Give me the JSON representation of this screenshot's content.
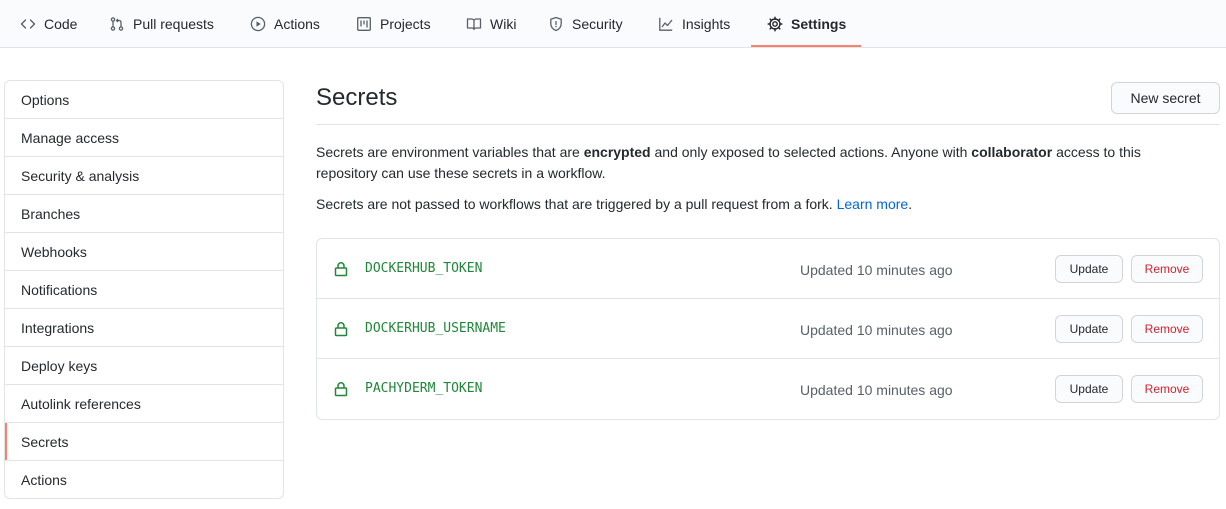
{
  "nav": {
    "tabs": [
      {
        "label": "Code",
        "icon": "code-icon"
      },
      {
        "label": "Pull requests",
        "icon": "pull-request-icon"
      },
      {
        "label": "Actions",
        "icon": "play-icon"
      },
      {
        "label": "Projects",
        "icon": "project-icon"
      },
      {
        "label": "Wiki",
        "icon": "book-icon"
      },
      {
        "label": "Security",
        "icon": "shield-icon"
      },
      {
        "label": "Insights",
        "icon": "graph-icon"
      },
      {
        "label": "Settings",
        "icon": "gear-icon",
        "active": true
      }
    ],
    "accent_color": "#f9826c"
  },
  "sidebar": {
    "items": [
      {
        "label": "Options"
      },
      {
        "label": "Manage access"
      },
      {
        "label": "Security & analysis"
      },
      {
        "label": "Branches"
      },
      {
        "label": "Webhooks"
      },
      {
        "label": "Notifications"
      },
      {
        "label": "Integrations"
      },
      {
        "label": "Deploy keys"
      },
      {
        "label": "Autolink references"
      },
      {
        "label": "Secrets",
        "active": true
      },
      {
        "label": "Actions"
      }
    ]
  },
  "main": {
    "title": "Secrets",
    "new_button": "New secret",
    "desc1": {
      "part1": "Secrets are environment variables that are ",
      "bold1": "encrypted",
      "part2": " and only exposed to selected actions. Anyone with ",
      "bold2": "collaborator",
      "part3": " access to this repository can use these secrets in a workflow."
    },
    "desc2": {
      "text": "Secrets are not passed to workflows that are triggered by a pull request from a fork. ",
      "link": "Learn more",
      "end": "."
    },
    "secrets": [
      {
        "name": "DOCKERHUB_TOKEN",
        "updated": "Updated 10 minutes ago",
        "update_label": "Update",
        "remove_label": "Remove"
      },
      {
        "name": "DOCKERHUB_USERNAME",
        "updated": "Updated 10 minutes ago",
        "update_label": "Update",
        "remove_label": "Remove"
      },
      {
        "name": "PACHYDERM_TOKEN",
        "updated": "Updated 10 minutes ago",
        "update_label": "Update",
        "remove_label": "Remove"
      }
    ],
    "secret_color": "#22863a",
    "remove_color": "#cb2431",
    "link_color": "#0366d6"
  }
}
